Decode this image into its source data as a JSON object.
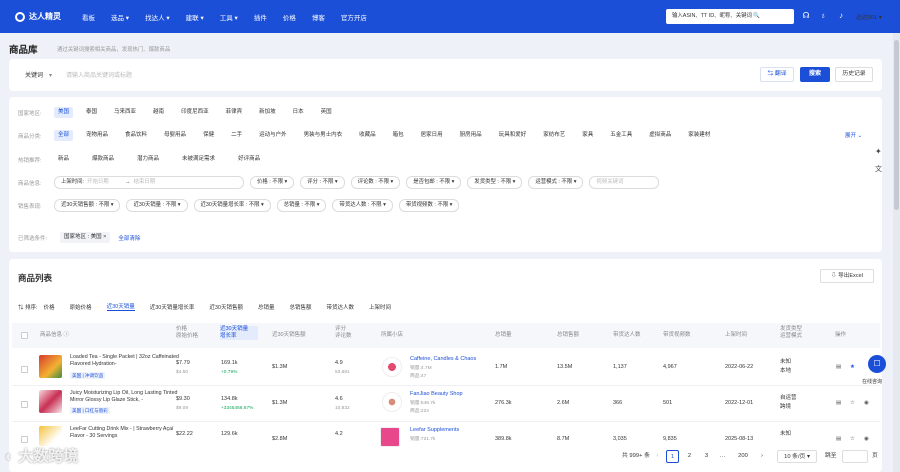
{
  "brand": {
    "name": "达人精灵",
    "accent": "#1b4fd8"
  },
  "nav": [
    "看板",
    "选品",
    "找达人",
    "建联",
    "工具",
    "插件",
    "价格",
    "博客",
    "官方开店"
  ],
  "top_search": {
    "placeholder": "输入ASIN、TT ID、昵称、关键词"
  },
  "user": {
    "name": "达达001"
  },
  "page": {
    "title": "商品库",
    "subtitle": "通过关键词搜索相关商品，发现热门、爆款商品"
  },
  "search": {
    "mode": "关键词",
    "placeholder": "请输入商品关键词或标题",
    "translate": "翻译",
    "search": "搜索",
    "history": "历史记录"
  },
  "filters": {
    "country": {
      "label": "国家地区:",
      "options": [
        "美国",
        "泰国",
        "马来西亚",
        "越南",
        "印度尼西亚",
        "菲律宾",
        "新加坡",
        "日本",
        "英国"
      ]
    },
    "category": {
      "label": "商品分类:",
      "options": [
        "全部",
        "宠物用品",
        "食品饮料",
        "母婴用品",
        "保健",
        "二手",
        "运动与户外",
        "男装与男士内衣",
        "收藏品",
        "箱包",
        "居家日用",
        "厨房用品",
        "玩具和爱好",
        "家纺布艺",
        "家具",
        "五金工具",
        "虚拟商品",
        "家装建材"
      ],
      "expand": "展开"
    },
    "feature": {
      "label": "热销推荐:",
      "options": [
        "新品",
        "爆款商品",
        "潜力商品",
        "未被满足需求",
        "好评商品"
      ]
    },
    "attr": {
      "label": "商品信息:",
      "listing_time": "上架时间:",
      "start_date": "开始日期",
      "end_date": "结束日期",
      "selects": [
        "价格 : 不限",
        "评分 : 不限",
        "评论数 : 不限",
        "是否包邮 : 不限",
        "发货类型 : 不限",
        "运营模式 : 不限"
      ],
      "product_name_placeholder": "视频关键词"
    },
    "sales": {
      "label": "销售表现:",
      "selects": [
        "近30天销售额 : 不限",
        "近30天销量 : 不限",
        "近30天销量增长率 : 不限",
        "总销量 : 不限",
        "带货达人数 : 不限",
        "带货视频数 : 不限"
      ]
    },
    "selected": {
      "label": "已筛选条件:",
      "tag": "国家地区 : 美国",
      "clear": "全部清除"
    }
  },
  "list": {
    "title": "商品列表",
    "export": "导出Excel",
    "sort_label": "排序:",
    "sorts": [
      "价格",
      "原始价格",
      "近30天销量",
      "近30天销量增长率",
      "近30天销售额",
      "总销量",
      "总销售额",
      "带货达人数",
      "上架时间"
    ],
    "columns": {
      "info": "商品信息",
      "price": "价格",
      "orig_price": "原始价格",
      "sales30": "近30天销量",
      "growth": "增长率",
      "revenue30": "近30天销售额",
      "rating": "评分",
      "reviews": "评论数",
      "shop": "所属小店",
      "total_sales": "总销量",
      "total_rev": "总销售额",
      "creators": "带货达人数",
      "videos": "带货视频数",
      "listed": "上架时间",
      "ship": "发货类型",
      "mode": "运营模式",
      "actions": "操作"
    },
    "rows": [
      {
        "name": "Loaded Tea - Single Packet | 32oz Caffeinated Flavored Hydration-",
        "badge": "美国 | 冲调饮品",
        "price": "$7.79",
        "orig": "$4.50",
        "sales30": "169.1k",
        "growth": "+0.79%",
        "revenue30": "$1.3M",
        "rating": "4.9",
        "reviews": "53,681",
        "shop": "Caffeine, Candles & Chaos",
        "shop_sales": "销量:4.7M",
        "shop_items": "商品:47",
        "total_sales": "1.7M",
        "total_rev": "13.5M",
        "creators": "1,137",
        "videos": "4,967",
        "listed": "2022-06-22",
        "ship": "未知",
        "mode": "本地"
      },
      {
        "name": "Juicy Moisturizing Lip Oil, Long Lasting Tinted Mirror Glossy Lip Glaze Stick, -",
        "badge": "美国 | 口红与唇彩",
        "price": "$9.30",
        "orig": "$9.09",
        "sales30": "134.8k",
        "growth": "+3345466.67%",
        "revenue30": "$1.3M",
        "rating": "4.6",
        "reviews": "10,832",
        "shop": "FanJiao Beauty Shop",
        "shop_sales": "销量:548.7k",
        "shop_items": "商品:224",
        "total_sales": "276.3k",
        "total_rev": "2.6M",
        "creators": "366",
        "videos": "501",
        "listed": "2022-12-01",
        "ship": "自运营",
        "mode": "跨境"
      },
      {
        "name": "LeeFar Cutting Drink Mix - | Strawberry Açaí Flavor - 30 Servings",
        "badge": "",
        "price": "$22.22",
        "orig": "",
        "sales30": "129.6k",
        "growth": "",
        "revenue30": "$2.8M",
        "rating": "4.2",
        "reviews": "",
        "shop": "Leefar Supplements",
        "shop_sales": "销量:721.7k",
        "shop_items": "",
        "total_sales": "389.8k",
        "total_rev": "8.7M",
        "creators": "3,035",
        "videos": "9,835",
        "listed": "2025-08-13",
        "ship": "未知",
        "mode": ""
      }
    ],
    "pagination": {
      "total": "共 999+ 条",
      "pages": [
        "1",
        "2",
        "3",
        "…",
        "200"
      ],
      "per_page": "10 条/页",
      "jump": "跳至",
      "jump_unit": "页"
    }
  },
  "side": {
    "consult": "在线咨询"
  },
  "watermark": "大数跨境"
}
